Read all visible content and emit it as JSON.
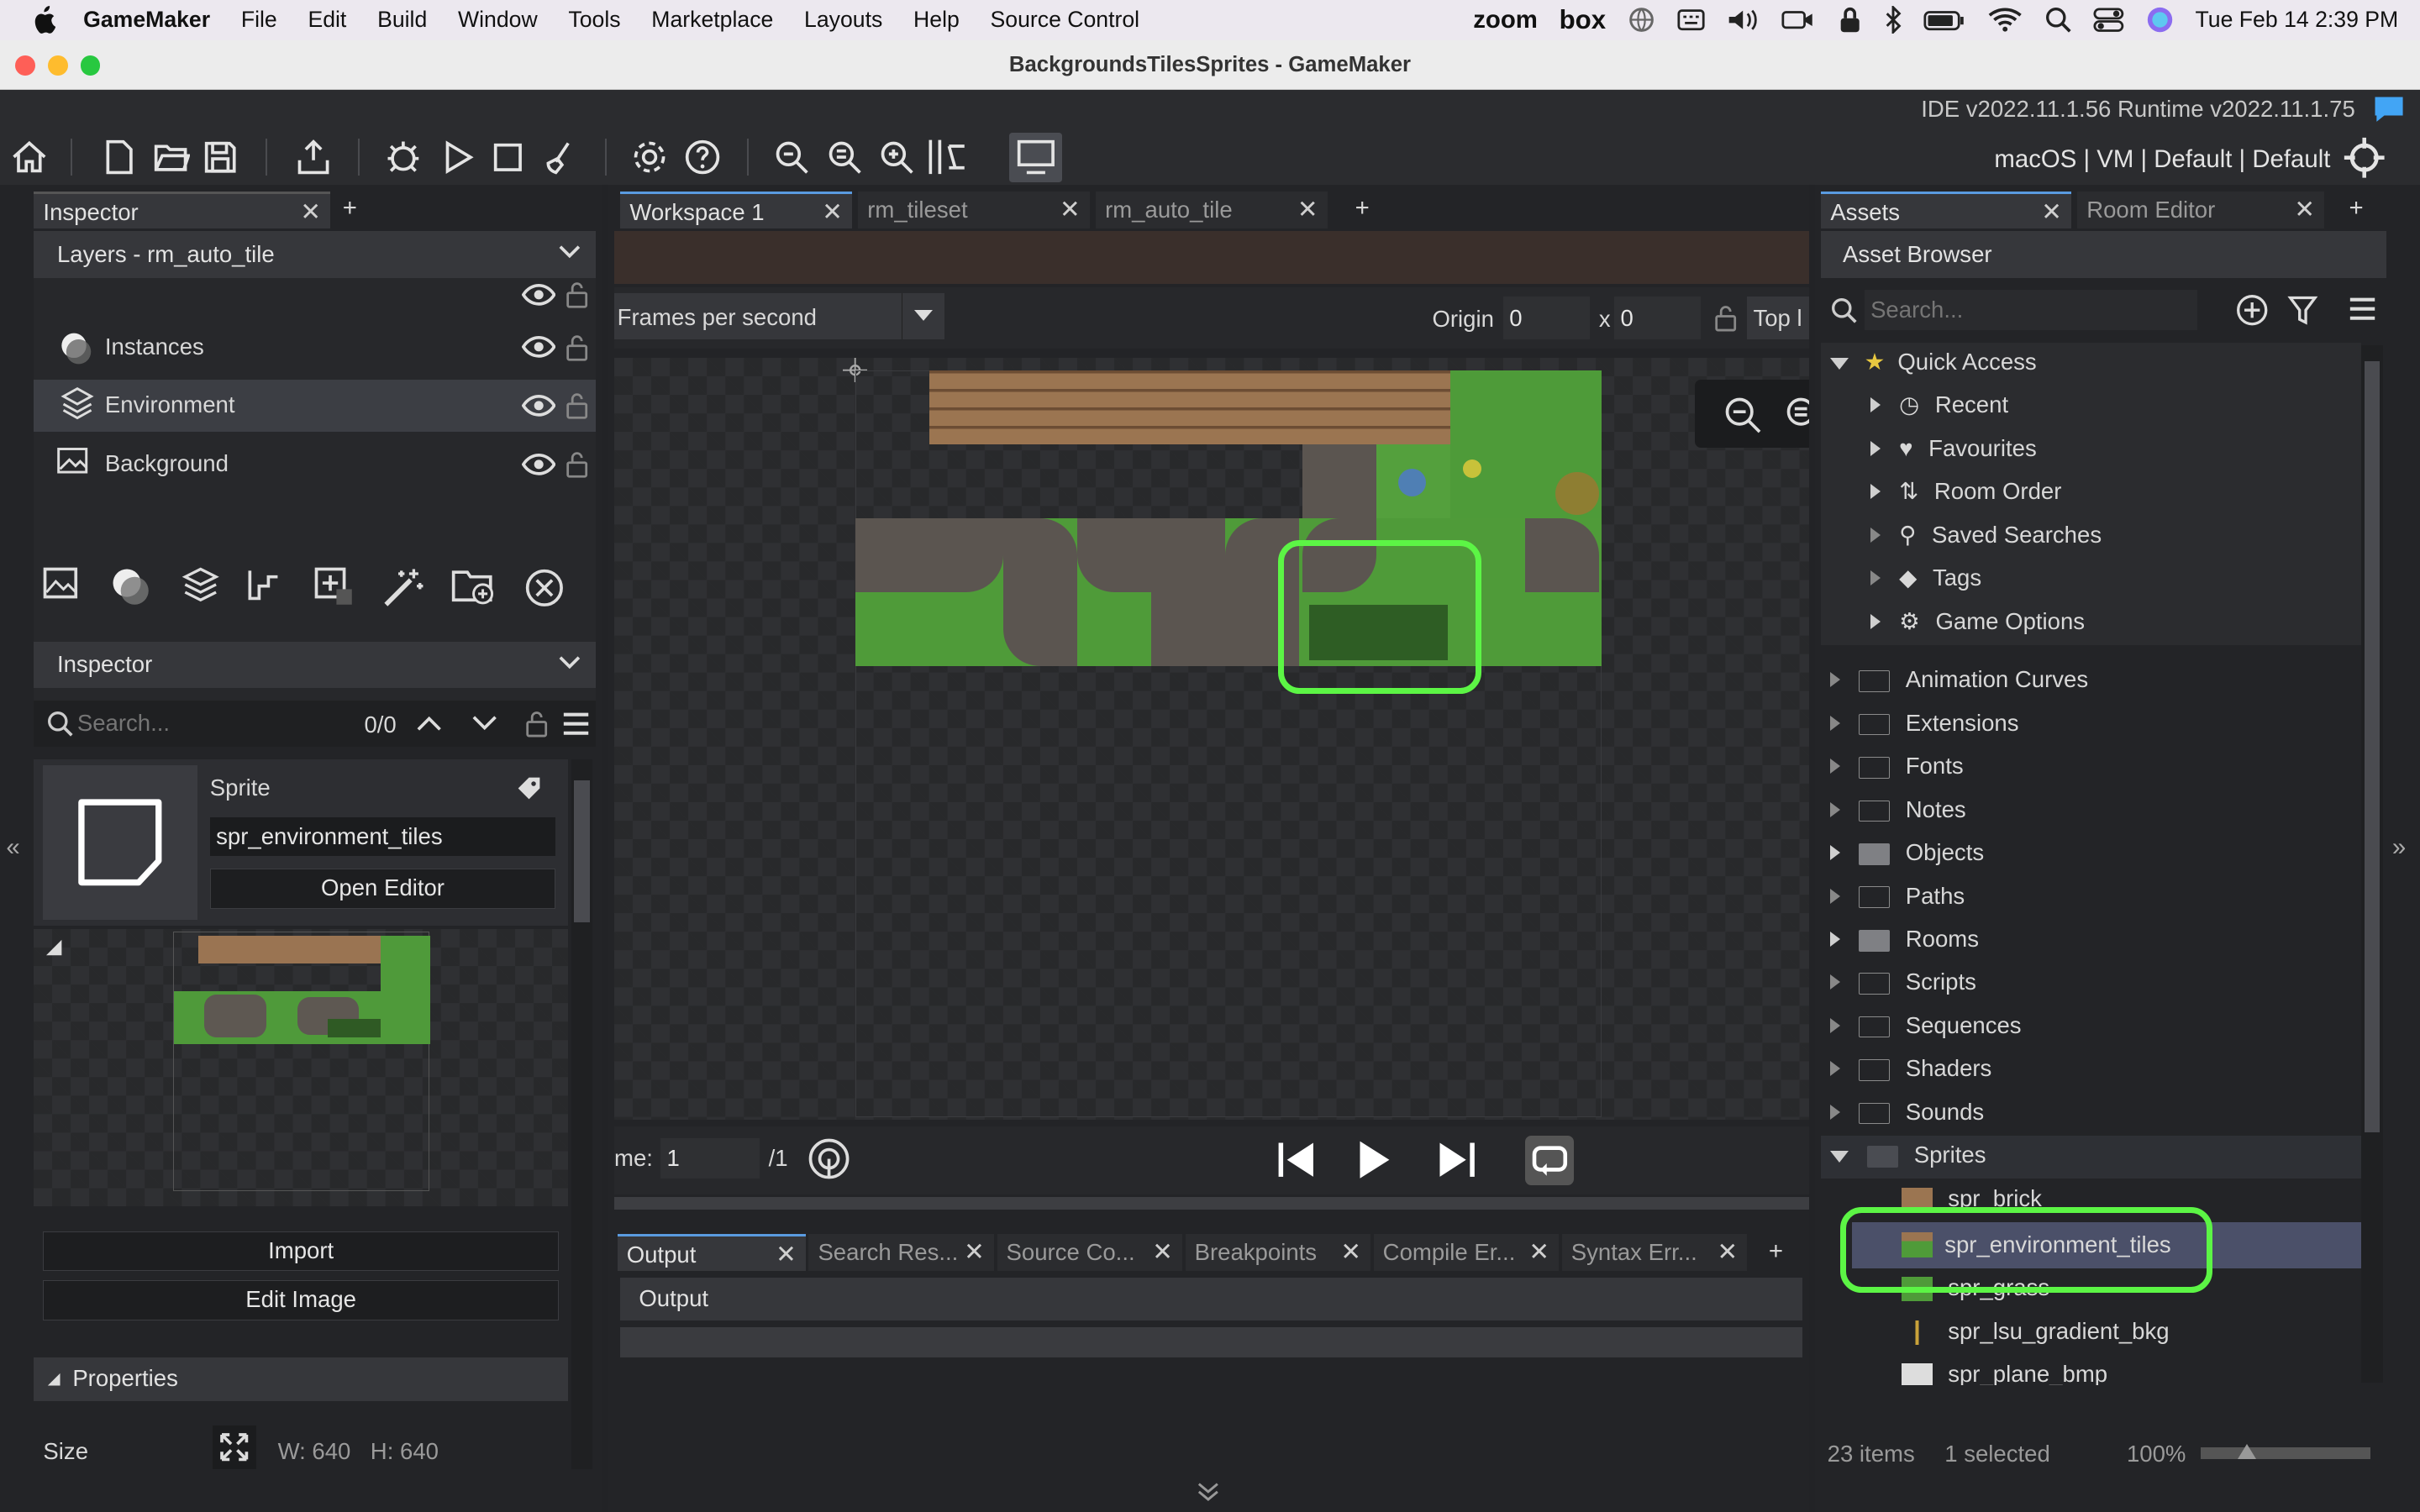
{
  "menubar": {
    "app": "GameMaker",
    "items": [
      "File",
      "Edit",
      "Build",
      "Window",
      "Tools",
      "Marketplace",
      "Layouts",
      "Help",
      "Source Control"
    ],
    "status_zoom": "zoom",
    "status_box": "box",
    "datetime": "Tue Feb 14  2:39 PM"
  },
  "window": {
    "title": "BackgroundsTilesSprites - GameMaker",
    "version": "IDE v2022.11.1.56  Runtime v2022.11.1.75",
    "target": "macOS | VM | Default | Default"
  },
  "left": {
    "tab": "Inspector",
    "layers_title": "Layers - rm_auto_tile",
    "layers": [
      "Instances",
      "Environment",
      "Background"
    ],
    "inspector_title": "Inspector",
    "search_placeholder": "Search...",
    "search_count": "0/0",
    "sprite_label": "Sprite",
    "sprite_name": "spr_environment_tiles",
    "open_editor": "Open Editor",
    "import": "Import",
    "edit_image": "Edit Image",
    "properties": "Properties",
    "size_label": "Size",
    "size_w": "W: 640",
    "size_h": "H: 640"
  },
  "center": {
    "tabs": [
      "Workspace 1",
      "rm_tileset",
      "rm_auto_tile"
    ],
    "fps_label": "Frames per second",
    "origin_label": "Origin",
    "origin_x": "0",
    "origin_x_label": "x",
    "origin_y": "0",
    "anchor": "Top l",
    "frame_label": "me:",
    "frame_value": "1",
    "frame_total": "/1"
  },
  "output": {
    "tabs": [
      "Output",
      "Search Res...",
      "Source Co...",
      "Breakpoints",
      "Compile Er...",
      "Syntax Err..."
    ],
    "title": "Output"
  },
  "right": {
    "tabs": [
      "Assets",
      "Room Editor"
    ],
    "browser_title": "Asset Browser",
    "search_placeholder": "Search...",
    "quick_access": "Quick Access",
    "quick_items": [
      "Recent",
      "Favourites",
      "Room Order",
      "Saved Searches",
      "Tags",
      "Game Options"
    ],
    "folders": [
      "Animation Curves",
      "Extensions",
      "Fonts",
      "Notes",
      "Objects",
      "Paths",
      "Rooms",
      "Scripts",
      "Sequences",
      "Shaders",
      "Sounds",
      "Sprites"
    ],
    "sprites": [
      "spr_brick",
      "spr_environment_tiles",
      "spr_grass",
      "spr_lsu_gradient_bkg",
      "spr_plane_bmp"
    ],
    "status_items": "23 items",
    "status_selected": "1 selected",
    "zoom": "100%"
  },
  "colors": {
    "highlight": "#5cf545",
    "selected_row": "#4b5069",
    "accent": "#42a5f5"
  }
}
